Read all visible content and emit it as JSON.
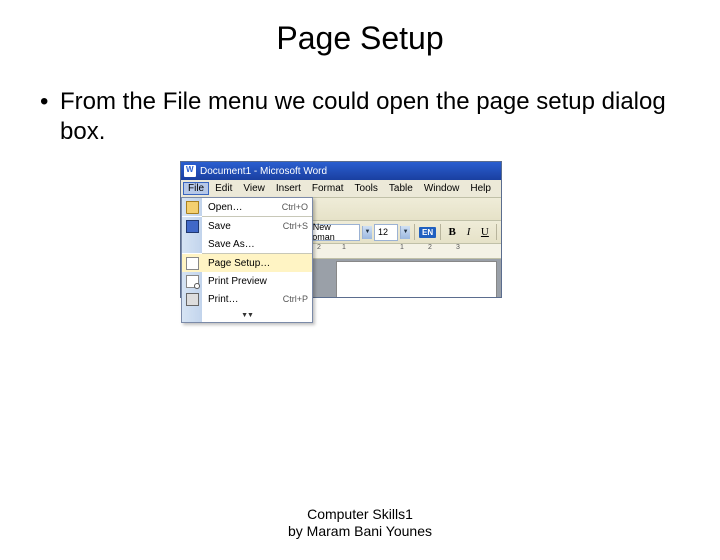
{
  "slide": {
    "title": "Page Setup",
    "bullet": "From the File menu we could open the page setup dialog box."
  },
  "screenshot": {
    "titlebar": "Document1 - Microsoft Word",
    "menus": [
      "File",
      "Edit",
      "View",
      "Insert",
      "Format",
      "Tools",
      "Table",
      "Window",
      "Help"
    ],
    "active_menu_index": 0,
    "font_name": "s New Roman",
    "font_size": "12",
    "lang": "EN",
    "format_buttons": {
      "bold": "B",
      "italic": "I",
      "underline": "U"
    },
    "ruler_numbers": [
      "2",
      "1",
      "1",
      "2",
      "3"
    ],
    "file_menu": {
      "open": {
        "label": "Open…",
        "shortcut": "Ctrl+O"
      },
      "save": {
        "label": "Save",
        "shortcut": "Ctrl+S"
      },
      "save_as": {
        "label": "Save As…",
        "shortcut": ""
      },
      "page_setup": {
        "label": "Page Setup…",
        "shortcut": ""
      },
      "print_preview": {
        "label": "Print Preview",
        "shortcut": ""
      },
      "print": {
        "label": "Print…",
        "shortcut": "Ctrl+P"
      }
    }
  },
  "footer": {
    "line1": "Computer Skills1",
    "line2": "by Maram Bani Younes"
  }
}
